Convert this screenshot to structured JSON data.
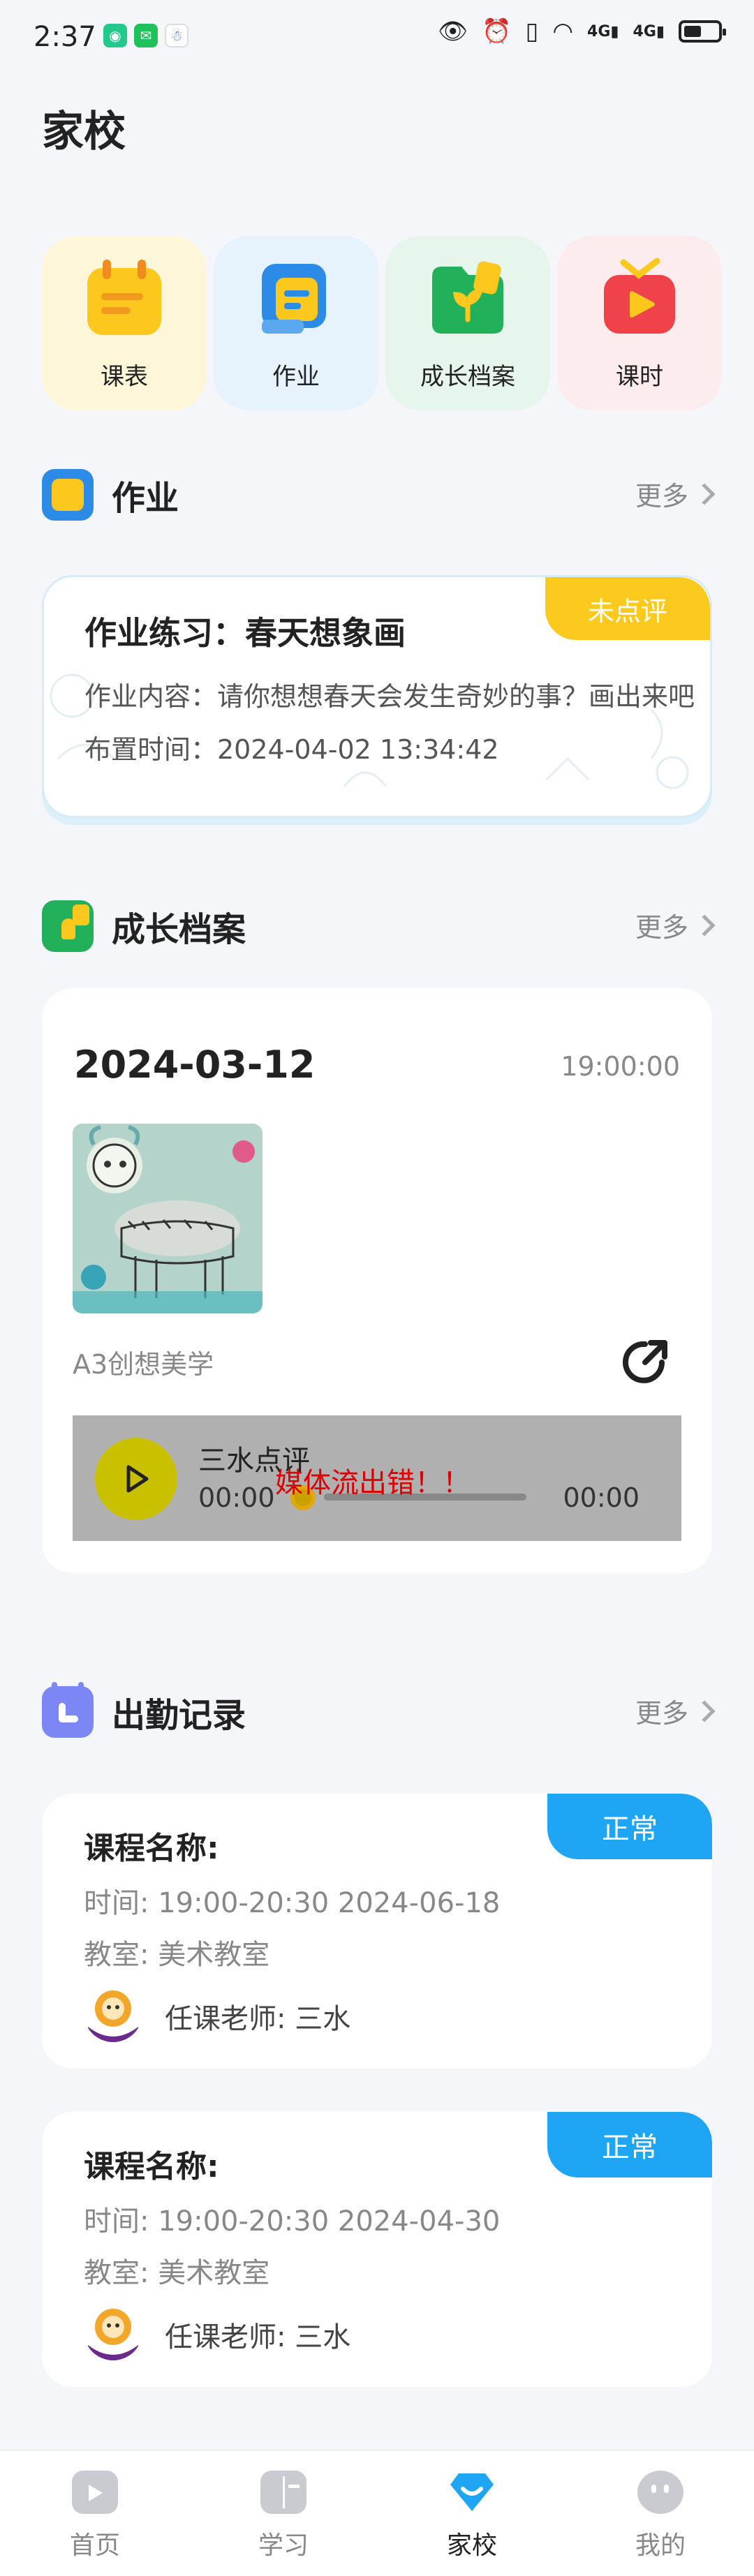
{
  "status_bar": {
    "time": "2:37",
    "signal_1": "4G",
    "signal_2": "4G"
  },
  "header": {
    "title": "家校"
  },
  "quick_nav": [
    {
      "label": "课表",
      "icon": "calendar-icon",
      "bg": "#fdf6d8"
    },
    {
      "label": "作业",
      "icon": "homework-icon",
      "bg": "#e6f3fd"
    },
    {
      "label": "成长档案",
      "icon": "growth-folder-icon",
      "bg": "#e6f6ec"
    },
    {
      "label": "课时",
      "icon": "tv-icon",
      "bg": "#fdeced"
    }
  ],
  "homework_section": {
    "title": "作业",
    "more": "更多",
    "card": {
      "badge": "未点评",
      "title": "作业练习：春天想象画",
      "content": "作业内容：请你想想春天会发生奇妙的事？画出来吧",
      "assigned": "布置时间：2024-04-02 13:34:42"
    }
  },
  "growth_section": {
    "title": "成长档案",
    "more": "更多",
    "card": {
      "date": "2024-03-12",
      "time": "19:00:00",
      "course": "A3创想美学",
      "player": {
        "title": "三水点评",
        "current": "00:00",
        "duration": "00:00",
        "error": "媒体流出错！！"
      }
    }
  },
  "attendance_section": {
    "title": "出勤记录",
    "more": "更多",
    "records": [
      {
        "status": "正常",
        "name": "课程名称:",
        "time": "时间:  19:00-20:30  2024-06-18",
        "room": "教室:  美术教室",
        "teacher": "任课老师:  三水"
      },
      {
        "status": "正常",
        "name": "课程名称:",
        "time": "时间:  19:00-20:30  2024-04-30",
        "room": "教室:  美术教室",
        "teacher": "任课老师:  三水"
      }
    ]
  },
  "bottom_nav": [
    {
      "label": "首页",
      "icon": "home-tv-icon",
      "active": false
    },
    {
      "label": "学习",
      "icon": "study-icon",
      "active": false
    },
    {
      "label": "家校",
      "icon": "home-school-icon",
      "active": true
    },
    {
      "label": "我的",
      "icon": "profile-icon",
      "active": false
    }
  ],
  "colors": {
    "accent_blue": "#1ea6f5",
    "badge_yellow": "#fcc91e",
    "background": "#f5f6fa"
  }
}
